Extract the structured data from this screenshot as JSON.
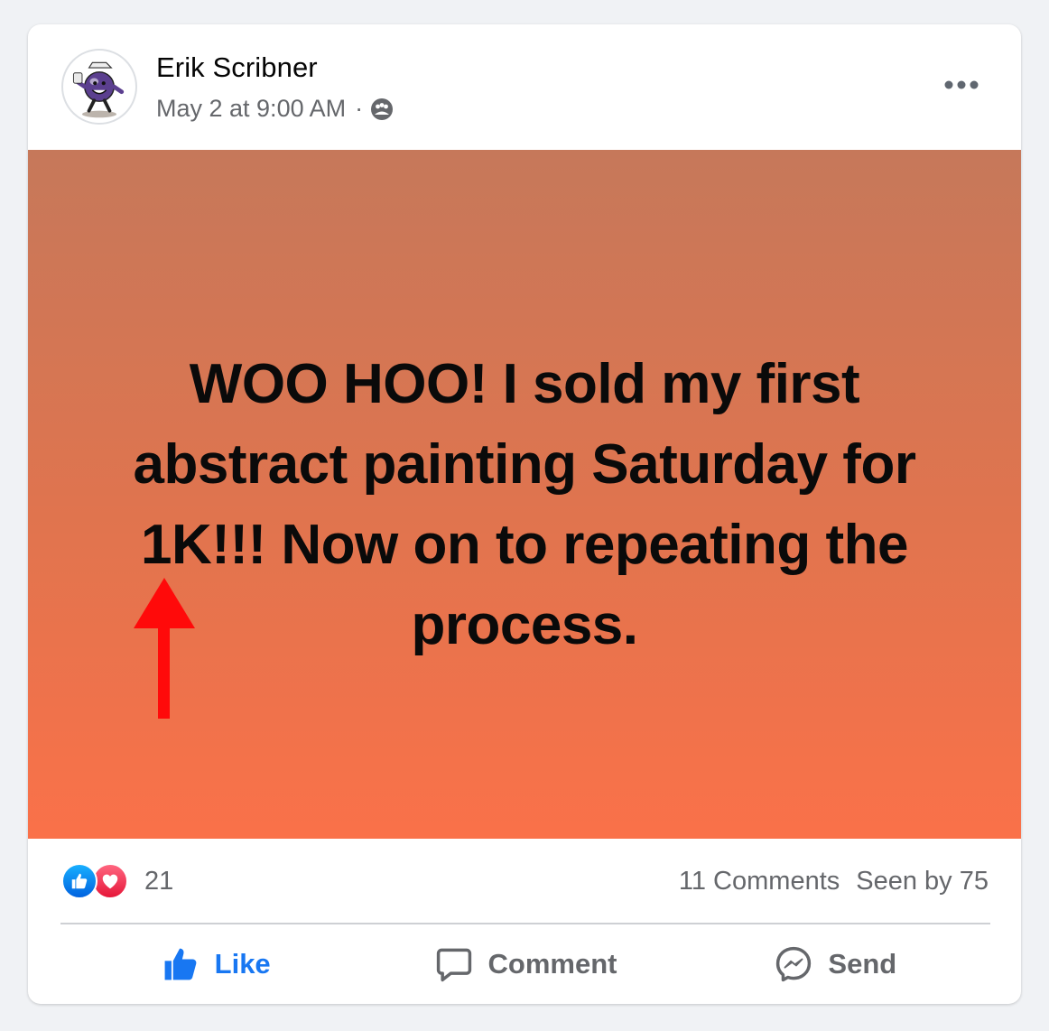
{
  "post": {
    "author": "Erik Scribner",
    "timestamp": "May 2 at 9:00 AM",
    "separator": "·",
    "audience_icon": "custom-audience-icon",
    "more_icon": "more-options-icon",
    "body_text": "WOO HOO! I sold my first abstract painting Saturday for 1K!!! Now on to repeating the process.",
    "background_gradient": [
      "#c6785a",
      "#fa7149"
    ],
    "annotation_arrow_color": "#ff0a0a"
  },
  "stats": {
    "reaction_icons": [
      "like-reaction-icon",
      "love-reaction-icon"
    ],
    "reaction_count": "21",
    "comments": "11 Comments",
    "seen_by": "Seen by 75"
  },
  "actions": {
    "like": {
      "label": "Like",
      "icon": "thumbs-up-icon",
      "color": "#1877f2"
    },
    "comment": {
      "label": "Comment",
      "icon": "comment-bubble-icon"
    },
    "send": {
      "label": "Send",
      "icon": "messenger-icon"
    }
  }
}
